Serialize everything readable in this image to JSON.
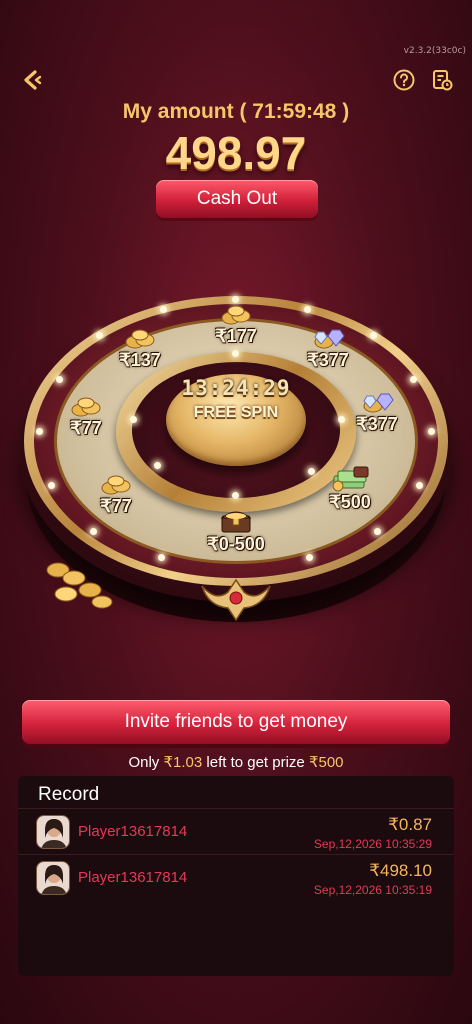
{
  "version": "v2.3.2(33c0c)",
  "header": {
    "amount_label": "My amount ( 71:59:48 )",
    "amount_value": "498.97",
    "cash_out_label": "Cash Out"
  },
  "wheel": {
    "timer": "13:24:29",
    "center_label": "FREE SPIN",
    "prizes": [
      {
        "label": "₹177",
        "icon": "coin-pile-icon"
      },
      {
        "label": "₹377",
        "icon": "gem-coins-icon"
      },
      {
        "label": "₹377",
        "icon": "gem-coins-icon"
      },
      {
        "label": "₹500",
        "icon": "cash-stack-icon"
      },
      {
        "label": "₹0-500",
        "icon": "treasure-chest-icon"
      },
      {
        "label": "₹77",
        "icon": "coin-pile-icon"
      },
      {
        "label": "₹77",
        "icon": "coin-pile-icon"
      },
      {
        "label": "₹137",
        "icon": "coin-pile-icon"
      }
    ]
  },
  "invite": {
    "button_label": "Invite friends to get money",
    "progress_prefix": "Only",
    "progress_amount": "₹1.03",
    "progress_middle": "left to get prize",
    "progress_prize": "₹500"
  },
  "records": {
    "title": "Record",
    "rows": [
      {
        "player": "Player13617814",
        "amount": "₹0.87",
        "time": "Sep,12,2026 10:35:29"
      },
      {
        "player": "Player13617814",
        "amount": "₹498.10",
        "time": "Sep,12,2026 10:35:19"
      }
    ]
  },
  "colors": {
    "accent_gold": "#f5c66a",
    "button_red": "#d4223c",
    "player_red": "#e23b56"
  }
}
